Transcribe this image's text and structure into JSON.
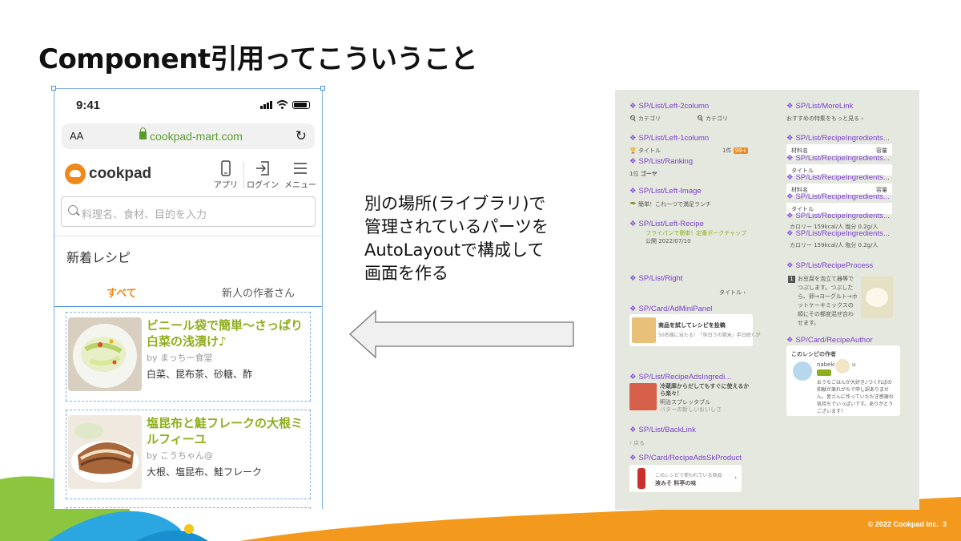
{
  "slide": {
    "title": "Component引用ってこういうこと",
    "footer": "© 2022 Cookpad Inc.",
    "page_number": "3",
    "description_lines": "別の場所(ライブラリ)で\n管理されているパーツを\nAutoLayoutで構成して\n画面を作る"
  },
  "phone": {
    "time": "9:41",
    "aa": "AA",
    "url": "cookpad-mart.com",
    "logo_text": "cookpad",
    "nav": [
      {
        "label": "アプリ",
        "icon": "phone-icon"
      },
      {
        "label": "ログイン",
        "icon": "login-icon"
      },
      {
        "label": "メニュー",
        "icon": "menu-icon"
      }
    ],
    "search_placeholder": "料理名、食材、目的を入力",
    "section_title": "新着レシピ",
    "tabs": [
      "すべて",
      "新人の作者さん"
    ],
    "recipes": [
      {
        "title": "ビニール袋で簡単〜さっぱり白菜の浅漬け♪",
        "author": "by まっちー食堂",
        "ingredients": "白菜、昆布茶、砂糖、酢"
      },
      {
        "title": "塩昆布と鮭フレークの大根ミルフィーユ",
        "author": "by こうちゃん@",
        "ingredients": "大根、塩昆布、鮭フレーク"
      }
    ]
  },
  "library": {
    "left": [
      {
        "name": "SP/List/Left-2column",
        "content": [
          "カテゴリ",
          "カテゴリ"
        ]
      },
      {
        "name": "SP/List/Left-1column",
        "content": [
          "タイトル",
          "1件",
          "99+"
        ]
      },
      {
        "name": "SP/List/Ranking",
        "content": [
          "1位",
          "ゴーヤ"
        ]
      },
      {
        "name": "SP/List/Left-Image",
        "content": [
          "簡単！これ一つで満足ランチ"
        ]
      },
      {
        "name": "SP/List/Left-Recipe",
        "content": [
          "フライパンで簡単！定番ポークチャップ",
          "公開 2022/07/10"
        ]
      },
      {
        "name": "SP/List/Right",
        "content": [
          "タイトル"
        ]
      },
      {
        "name": "SP/Card/AdMiniPanel",
        "content": [
          "商品を試してレシピを投稿",
          "50名様に当たる！「休日うの贅米」手日続くが"
        ]
      },
      {
        "name": "SP/List/RecipeAdsIngredi...",
        "content": [
          "冷蔵庫からだしてもすぐに使えるから楽々！",
          "明治スプレッタブル",
          "バターの新しいおいしさ"
        ]
      },
      {
        "name": "SP/List/BackLink",
        "content": [
          "‹ 戻る"
        ]
      },
      {
        "name": "SP/Card/RecipeAdsSkProduct",
        "content": [
          "このレシピで使われている商品",
          "液みそ 料亭の味"
        ]
      }
    ],
    "right": [
      {
        "name": "SP/List/MoreLink",
        "content": [
          "おすすめの特集をもっと見る"
        ]
      },
      {
        "name": "SP/List/RecipeIngredients...",
        "content": [
          "材料名",
          "容量"
        ]
      },
      {
        "name": "SP/List/RecipeIngredients...",
        "content": [
          "タイトル"
        ]
      },
      {
        "name": "SP/List/RecipeIngredients...",
        "content": [
          "材料名",
          "容量"
        ]
      },
      {
        "name": "SP/List/RecipeIngredients...",
        "content": [
          "タイトル"
        ]
      },
      {
        "name": "SP/List/RecipeIngredients...",
        "content": [
          "カロリー 159kcal/人 塩分 0.2g/人"
        ]
      },
      {
        "name": "SP/List/RecipeIngredients...",
        "content": [
          "カロリー 159kcal/人 塩分 0.2g/人"
        ]
      },
      {
        "name": "SP/List/RecipeProcess",
        "content": [
          "お豆腐を泡立て器等でつぶします。つぶしたら、卵→ヨーグルト→ホットケーキミックスの順にその都度混ぜ合わせます。"
        ]
      },
      {
        "name": "SP/Card/RecipeAuthor",
        "content": [
          "このレシピの作者",
          "nabeko",
          "u",
          "おうちごはんが大好き♪つくればの和献が楽れがちで申し訳ありません。皆さんに作っていただき感謝の気持ちでいっぱいです。ありがとうございます！"
        ]
      }
    ]
  },
  "colors": {
    "accent_orange": "#f0891a",
    "recipe_green": "#8fae1b",
    "component_purple": "#7b3fd0",
    "url_green": "#5a9c2c",
    "library_bg": "#e5e8de"
  }
}
